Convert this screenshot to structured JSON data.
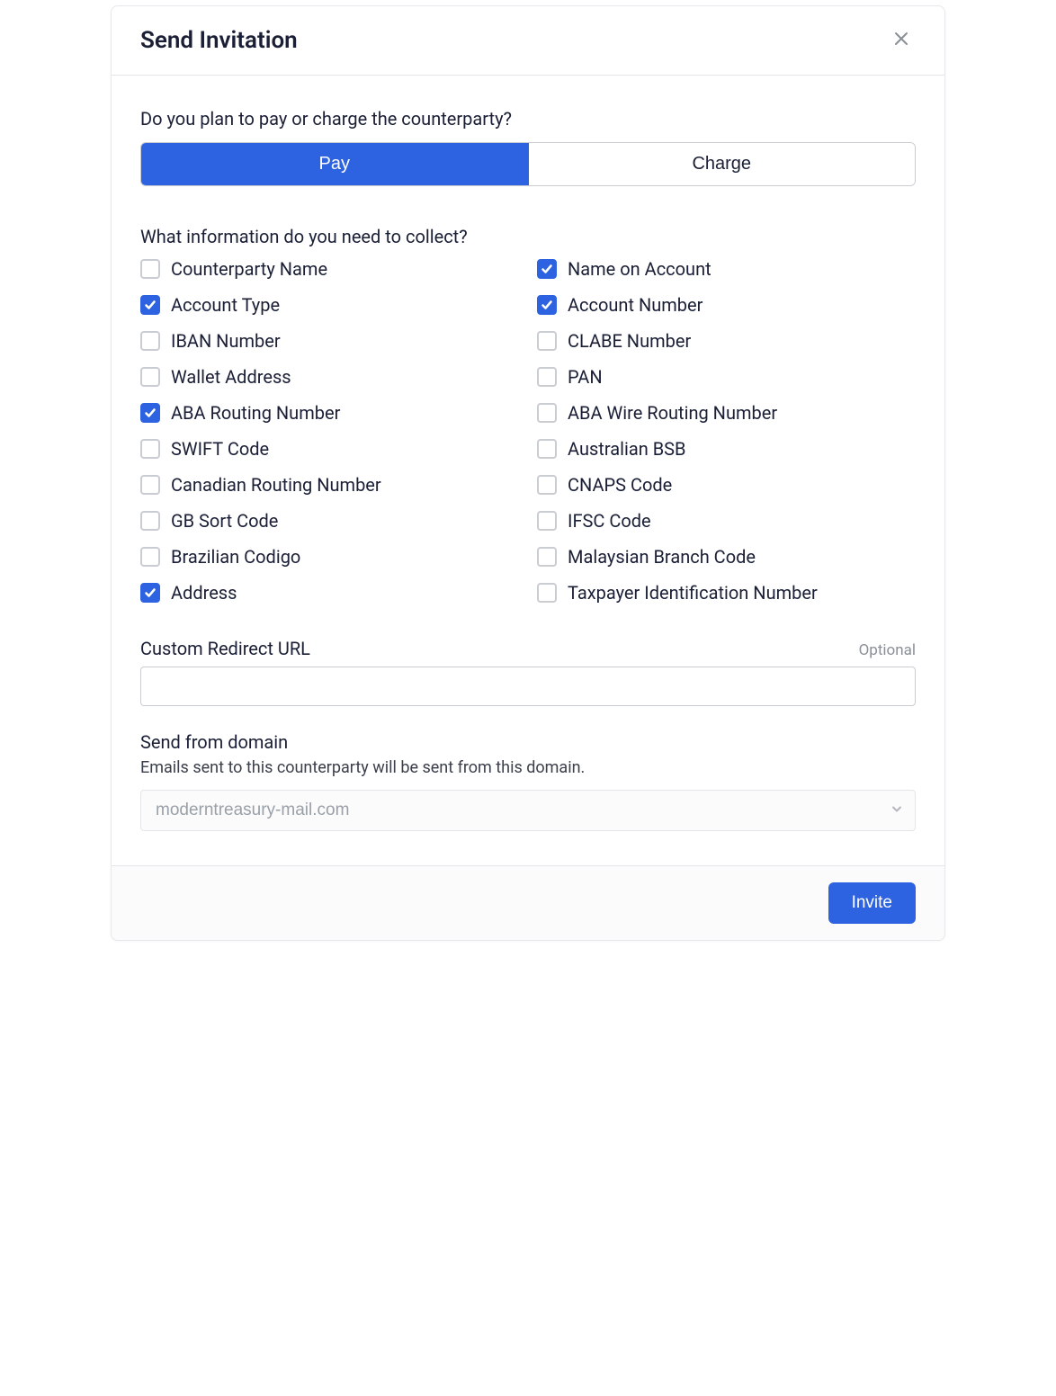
{
  "header": {
    "title": "Send Invitation"
  },
  "question1": "Do you plan to pay or charge the counterparty?",
  "toggle": {
    "pay": "Pay",
    "charge": "Charge",
    "active": "pay"
  },
  "question2": "What information do you need to collect?",
  "fields": {
    "counterparty_name": {
      "label": "Counterparty Name",
      "checked": false
    },
    "name_on_account": {
      "label": "Name on Account",
      "checked": true
    },
    "account_type": {
      "label": "Account Type",
      "checked": true
    },
    "account_number": {
      "label": "Account Number",
      "checked": true
    },
    "iban_number": {
      "label": "IBAN Number",
      "checked": false
    },
    "clabe_number": {
      "label": "CLABE Number",
      "checked": false
    },
    "wallet_address": {
      "label": "Wallet Address",
      "checked": false
    },
    "pan": {
      "label": "PAN",
      "checked": false
    },
    "aba_routing_number": {
      "label": "ABA Routing Number",
      "checked": true
    },
    "aba_wire_routing": {
      "label": "ABA Wire Routing Number",
      "checked": false
    },
    "swift_code": {
      "label": "SWIFT Code",
      "checked": false
    },
    "australian_bsb": {
      "label": "Australian BSB",
      "checked": false
    },
    "canadian_routing": {
      "label": "Canadian Routing Number",
      "checked": false
    },
    "cnaps_code": {
      "label": "CNAPS Code",
      "checked": false
    },
    "gb_sort_code": {
      "label": "GB Sort Code",
      "checked": false
    },
    "ifsc_code": {
      "label": "IFSC Code",
      "checked": false
    },
    "brazilian_codigo": {
      "label": "Brazilian Codigo",
      "checked": false
    },
    "malaysian_branch": {
      "label": "Malaysian Branch Code",
      "checked": false
    },
    "address": {
      "label": "Address",
      "checked": true
    },
    "taxpayer_id": {
      "label": "Taxpayer Identification Number",
      "checked": false
    }
  },
  "field_order": [
    "counterparty_name",
    "name_on_account",
    "account_type",
    "account_number",
    "iban_number",
    "clabe_number",
    "wallet_address",
    "pan",
    "aba_routing_number",
    "aba_wire_routing",
    "swift_code",
    "australian_bsb",
    "canadian_routing",
    "cnaps_code",
    "gb_sort_code",
    "ifsc_code",
    "brazilian_codigo",
    "malaysian_branch",
    "address",
    "taxpayer_id"
  ],
  "redirect": {
    "label": "Custom Redirect URL",
    "optional": "Optional",
    "value": ""
  },
  "domain": {
    "label": "Send from domain",
    "helper": "Emails sent to this counterparty will be sent from this domain.",
    "value": "moderntreasury-mail.com"
  },
  "footer": {
    "invite": "Invite"
  }
}
